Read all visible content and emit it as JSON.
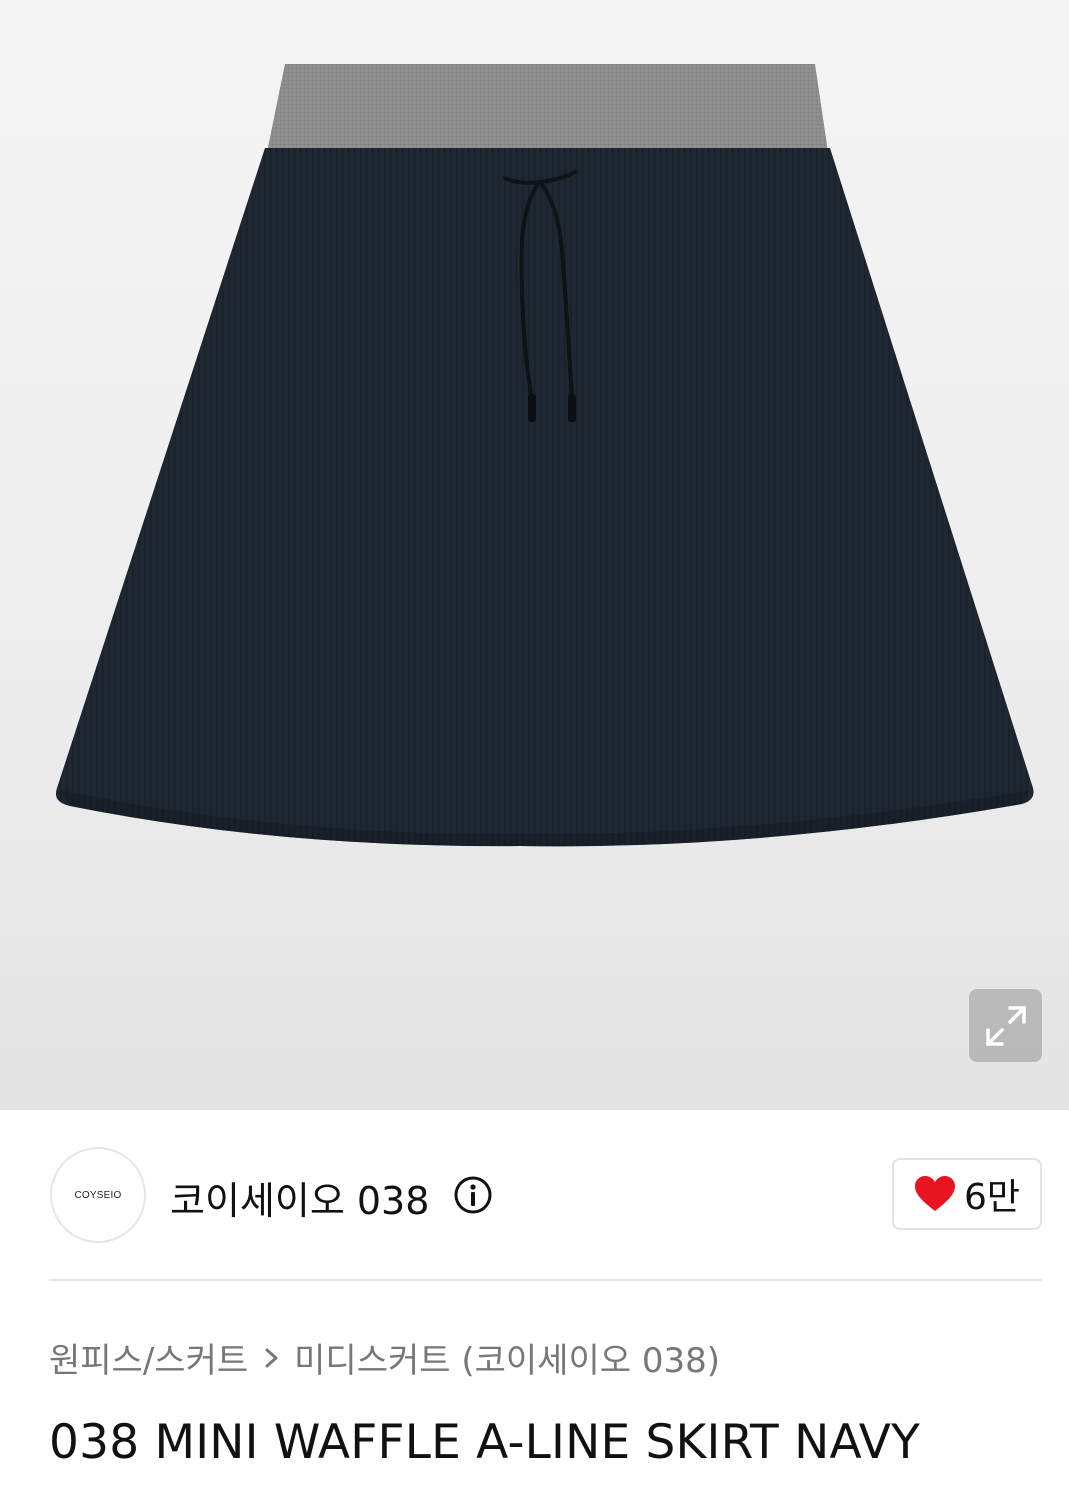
{
  "product": {
    "image_alt": "038 MINI WAFFLE A-LINE SKIRT NAVY",
    "colors": {
      "skirt": "#1f2832",
      "waistband": "#8a8a8a"
    }
  },
  "brand": {
    "logo_text": "COYSEIO",
    "name": "코이세이오 038",
    "info_icon": "info-circle-icon"
  },
  "like": {
    "icon": "heart-icon",
    "count": "6만",
    "color": "#e8141f"
  },
  "breadcrumb": {
    "category": "원피스/스커트",
    "subcategory": "미디스커트 (코이세이오 038)"
  },
  "title": "038 MINI WAFFLE A-LINE SKIRT NAVY"
}
